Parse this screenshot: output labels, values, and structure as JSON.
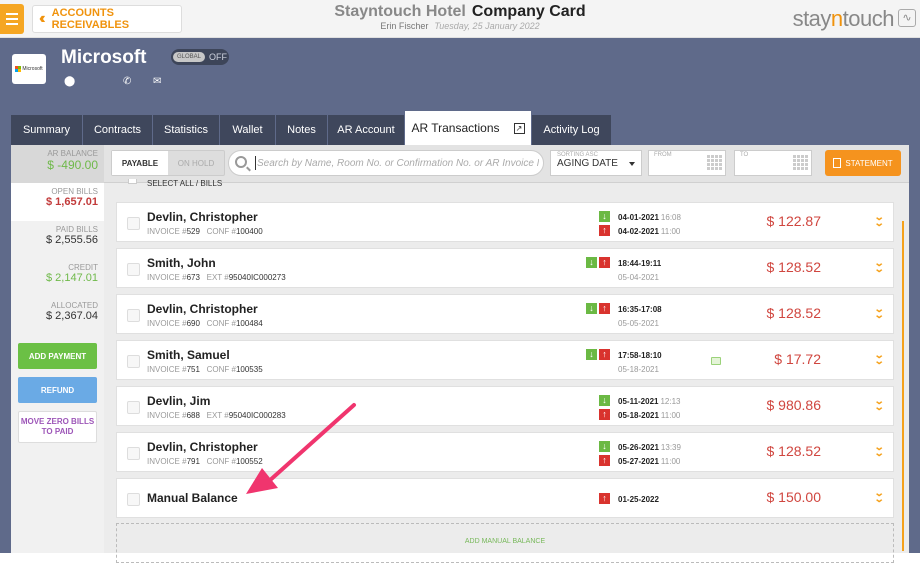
{
  "header": {
    "back_label": "ACCOUNTS RECEIVABLES",
    "hotel": "Stayntouch Hotel",
    "title": "Company Card",
    "user": "Erin Fischer",
    "date": "Tuesday, 25 January 2022",
    "logo_a": "stay",
    "logo_b": "n",
    "logo_c": "touch"
  },
  "company": {
    "name": "Microsoft",
    "thumb_text": "Microsoft",
    "toggle_global": "GLOBAL",
    "toggle_state": "OFF",
    "icons": [
      "location-pin-icon",
      "phone-icon",
      "envelope-icon"
    ]
  },
  "tabs": [
    "Summary",
    "Contracts",
    "Statistics",
    "Wallet",
    "Notes",
    "AR Account",
    "AR Transactions",
    "Activity Log"
  ],
  "active_tab": "AR Transactions",
  "sidebar": {
    "ar_balance_label": "AR BALANCE",
    "ar_balance": "$ -490.00",
    "open_bills_label": "OPEN BILLS",
    "open_bills": "$ 1,657.01",
    "paid_bills_label": "PAID BILLS",
    "paid_bills": "$ 2,555.56",
    "credit_label": "CREDIT",
    "credit": "$ 2,147.01",
    "allocated_label": "ALLOCATED",
    "allocated": "$ 2,367.04",
    "add_payment": "ADD PAYMENT",
    "refund": "REFUND",
    "move_zero": "MOVE ZERO BILLS TO PAID"
  },
  "filters": {
    "payable": "PAYABLE",
    "on_hold": "ON HOLD",
    "search_placeholder": "Search by Name, Room No. or Confirmation No. or AR Invoice No.",
    "sort_label": "SORTING ASC",
    "sort_value": "AGING DATE",
    "from_label": "FROM",
    "to_label": "TO",
    "statement": "STATEMENT",
    "select_all": "SELECT ALL / BILLS"
  },
  "rows": [
    {
      "name": "Devlin, Christopher",
      "invoice_label": "INVOICE #",
      "invoice": "529",
      "ref_label": "CONF #",
      "ref": "100400",
      "line1": "04-01-2021",
      "time1": "16:08",
      "line2": "04-02-2021",
      "time2": "11:00",
      "amount": "$ 122.87"
    },
    {
      "name": "Smith, John",
      "invoice_label": "INVOICE #",
      "invoice": "673",
      "ref_label": "EXT #",
      "ref": "95040IC000273",
      "line1": "18:44-19:11",
      "time1": "",
      "line2": "05-04-2021",
      "time2": "",
      "amount": "$ 128.52"
    },
    {
      "name": "Devlin, Christopher",
      "invoice_label": "INVOICE #",
      "invoice": "690",
      "ref_label": "CONF #",
      "ref": "100484",
      "line1": "16:35-17:08",
      "time1": "",
      "line2": "05-05-2021",
      "time2": "",
      "amount": "$ 128.52"
    },
    {
      "name": "Smith, Samuel",
      "invoice_label": "INVOICE #",
      "invoice": "751",
      "ref_label": "CONF #",
      "ref": "100535",
      "line1": "17:58-18:10",
      "time1": "",
      "line2": "05-18-2021",
      "time2": "",
      "amount": "$ 17.72"
    },
    {
      "name": "Devlin, Jim",
      "invoice_label": "INVOICE #",
      "invoice": "688",
      "ref_label": "EXT #",
      "ref": "95040IC000283",
      "line1": "05-11-2021",
      "time1": "12:13",
      "line2": "05-18-2021",
      "time2": "11:00",
      "amount": "$ 980.86"
    },
    {
      "name": "Devlin, Christopher",
      "invoice_label": "INVOICE #",
      "invoice": "791",
      "ref_label": "CONF #",
      "ref": "100552",
      "line1": "05-26-2021",
      "time1": "13:39",
      "line2": "05-27-2021",
      "time2": "11:00",
      "amount": "$ 128.52"
    },
    {
      "name": "Manual Balance",
      "line1": "01-25-2022",
      "amount": "$ 150.00"
    }
  ],
  "add_manual_balance": "ADD MANUAL BALANCE",
  "colors": {
    "accent": "#f5a11b",
    "header_bg": "#5f6a8a",
    "amount": "#d0463f",
    "green": "#6bb944",
    "red": "#d9332e",
    "annotation_arrow": "#f0356e"
  }
}
